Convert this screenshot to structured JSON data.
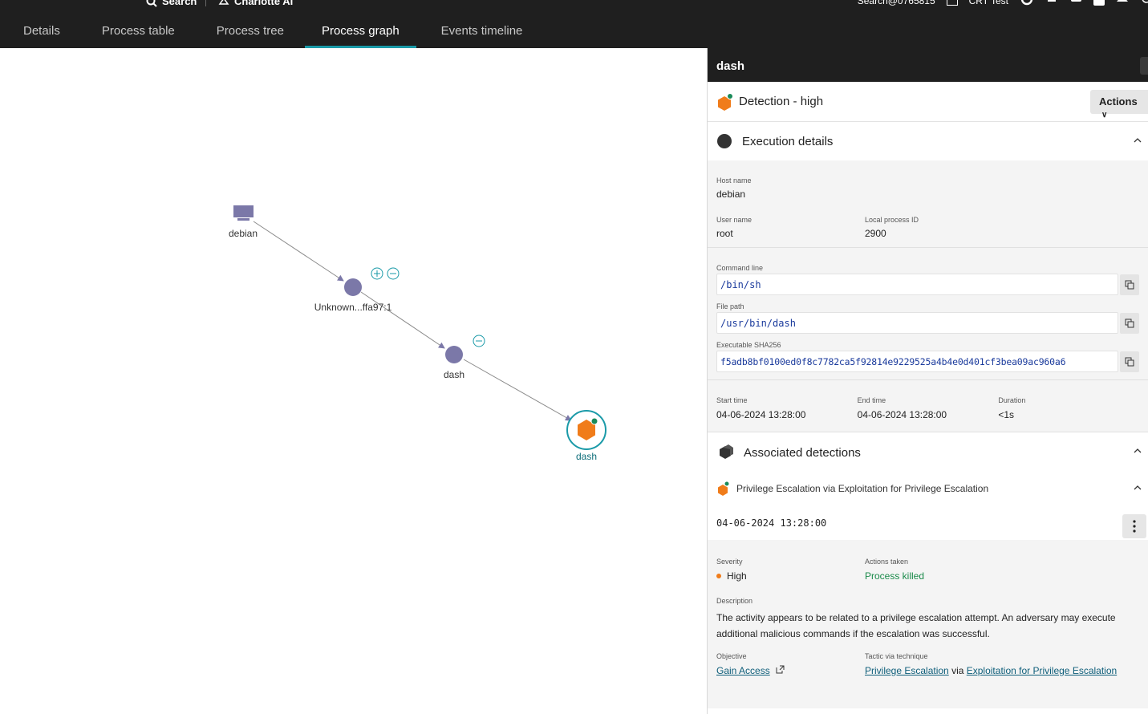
{
  "topbar": {
    "search_label": "Search",
    "ai_label": "Charlotte AI",
    "user_email": "Search@0765815",
    "tenant_label": "CRT Test"
  },
  "tabs": [
    {
      "label": "Details"
    },
    {
      "label": "Process table"
    },
    {
      "label": "Process tree"
    },
    {
      "label": "Process graph"
    },
    {
      "label": "Events timeline"
    }
  ],
  "graph": {
    "nodes": [
      {
        "label": "debian",
        "kind": "host"
      },
      {
        "label": "Unknown...ffa97:1",
        "kind": "process"
      },
      {
        "label": "dash",
        "kind": "process"
      },
      {
        "label": "dash",
        "kind": "detection"
      }
    ],
    "colors": {
      "node": "#7b78a8",
      "selected_ring": "#1a9aa8",
      "detection": "#f07c1a",
      "edge": "#8a8a8a"
    }
  },
  "panel": {
    "title": "dash",
    "detection_label": "Detection - high",
    "actions_label": "Actions",
    "execution": {
      "title": "Execution details",
      "host_label": "Host name",
      "host": "debian",
      "user_label": "User name",
      "user": "root",
      "pid_label": "Local process ID",
      "pid": "2900",
      "cmd_label": "Command line",
      "cmd": "/bin/sh",
      "path_label": "File path",
      "path": "/usr/bin/dash",
      "sha_label": "Executable SHA256",
      "sha": "f5adb8bf0100ed0f8c7782ca5f92814e9229525a4b4e0d401cf3bea09ac960a6",
      "start_label": "Start time",
      "start": "04-06-2024 13:28:00",
      "end_label": "End time",
      "end": "04-06-2024 13:28:00",
      "dur_label": "Duration",
      "dur": "<1s"
    },
    "assoc": {
      "title": "Associated detections",
      "item_title": "Privilege Escalation via Exploitation for Privilege Escalation",
      "timestamp": "04-06-2024 13:28:00",
      "severity_label": "Severity",
      "severity": "High",
      "actions_label": "Actions taken",
      "actions": "Process killed",
      "desc_label": "Description",
      "desc": "The activity appears to be related to a privilege escalation attempt. An adversary may execute additional malicious commands if the escalation was successful.",
      "objective_label": "Objective",
      "objective": "Gain Access",
      "tactic_label": "Tactic via technique",
      "tactic": "Privilege Escalation",
      "via": "via",
      "technique": "Exploitation for Privilege Escalation"
    }
  }
}
